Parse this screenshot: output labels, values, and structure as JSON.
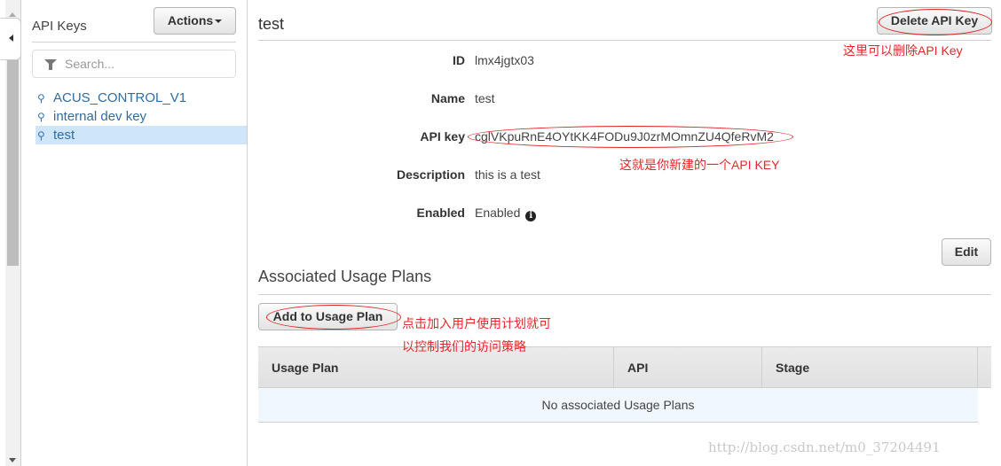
{
  "sidebar": {
    "title": "API Keys",
    "actions_label": "Actions",
    "search_placeholder": "Search...",
    "keys": [
      {
        "label": "ACUS_CONTROL_V1",
        "selected": false
      },
      {
        "label": "internal dev key",
        "selected": false
      },
      {
        "label": "test",
        "selected": true
      }
    ],
    "icons": {
      "filter": "filter-icon",
      "key": "key-icon",
      "collapse": "chevron-left-icon"
    }
  },
  "main": {
    "title": "test",
    "delete_label": "Delete API Key",
    "fields": [
      {
        "label": "ID",
        "value": "lmx4jgtx03"
      },
      {
        "label": "Name",
        "value": "test"
      },
      {
        "label": "API key",
        "value": "cglVKpuRnE4OYtKK4FODu9J0zrMOmnZU4QfeRvM2"
      },
      {
        "label": "Description",
        "value": "this is a test"
      },
      {
        "label": "Enabled",
        "value": "Enabled"
      }
    ],
    "edit_label": "Edit",
    "usage_plans": {
      "title": "Associated Usage Plans",
      "add_label": "Add to Usage Plan",
      "columns": [
        "Usage Plan",
        "API",
        "Stage"
      ],
      "empty_message": "No associated Usage Plans"
    }
  },
  "annotations": {
    "delete_note": "这里可以删除API Key",
    "key_note": "这就是你新建的一个API KEY",
    "plan_note_line1": "点击加入用户使用计划就可",
    "plan_note_line2": "以控制我们的访问策略",
    "color": "#e8262a"
  },
  "watermark": "http://blog.csdn.net/m0_37204491"
}
